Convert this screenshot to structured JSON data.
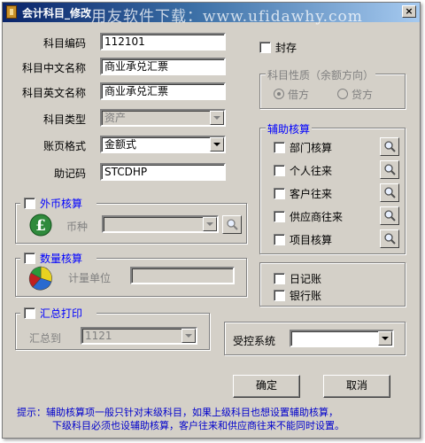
{
  "window": {
    "title": "会计科目_修改",
    "watermark": "用友软件下载：www.ufidawhy.com",
    "close_label": "×"
  },
  "form": {
    "code_label": "科目编码",
    "code_value": "112101",
    "cn_name_label": "科目中文名称",
    "cn_name_value": "商业承兑汇票",
    "en_name_label": "科目英文名称",
    "en_name_value": "商业承兑汇票",
    "type_label": "科目类型",
    "type_value": "资产",
    "format_label": "账页格式",
    "format_value": "金额式",
    "mnemonic_label": "助记码",
    "mnemonic_value": "STCDHP"
  },
  "sealed": {
    "label": "封存",
    "checked": false
  },
  "nature": {
    "legend": "科目性质（余额方向）",
    "debit_label": "借方",
    "credit_label": "贷方",
    "selected": "借方"
  },
  "aux": {
    "legend": "辅助核算",
    "items": [
      {
        "label": "部门核算",
        "checked": false
      },
      {
        "label": "个人往来",
        "checked": false
      },
      {
        "label": "客户往来",
        "checked": false
      },
      {
        "label": "供应商往来",
        "checked": false
      },
      {
        "label": "项目核算",
        "checked": false
      }
    ]
  },
  "foreign": {
    "label": "外币核算",
    "checked": false,
    "currency_label": "币种",
    "currency_value": ""
  },
  "quantity": {
    "label": "数量核算",
    "checked": false,
    "unit_label": "计量单位",
    "unit_value": ""
  },
  "journal": {
    "daily_label": "日记账",
    "bank_label": "银行账"
  },
  "summary": {
    "label": "汇总打印",
    "checked": false,
    "to_label": "汇总到",
    "to_value": "1121"
  },
  "controlled": {
    "label": "受控系统",
    "value": ""
  },
  "buttons": {
    "ok": "确定",
    "cancel": "取消"
  },
  "hint": {
    "line1": "提示：辅助核算项一般只针对末级科目，如果上级科目也想设置辅助核算，",
    "line2": "下级科目必须也设辅助核算，客户往来和供应商往来不能同时设置。"
  },
  "colors": {
    "title_start": "#0a246a",
    "title_end": "#a6caf0",
    "face": "#d4d0c8",
    "group_legend": "#0000ff",
    "hint": "#0000cc"
  }
}
